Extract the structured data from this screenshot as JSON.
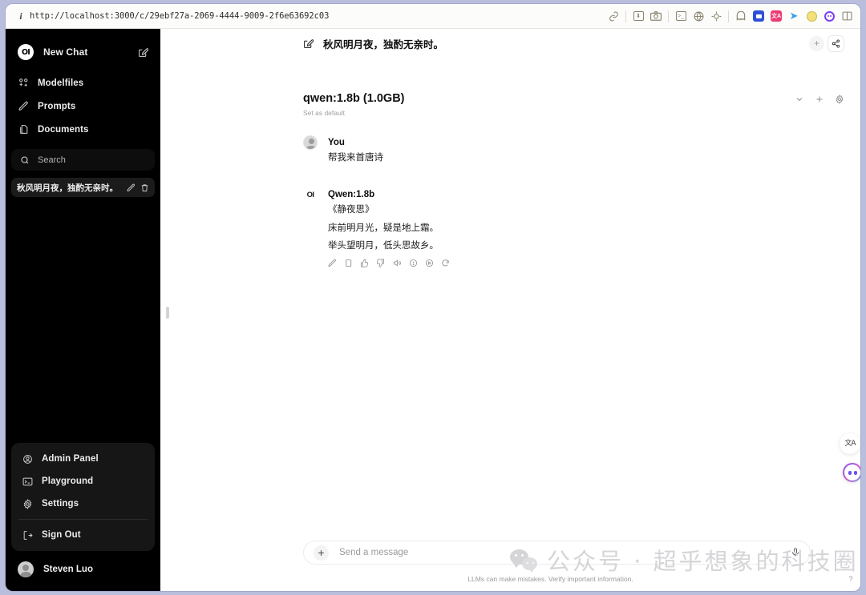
{
  "browser": {
    "url": "http://localhost:3000/c/29ebf27a-2069-4444-9009-2f6e63692c03",
    "info_icon": "i",
    "toolbar_icons": [
      {
        "name": "link-icon",
        "glyph": "⎇"
      },
      {
        "name": "download-box-icon",
        "glyph": "⬇"
      },
      {
        "name": "camera-icon",
        "glyph": "□"
      },
      {
        "name": "terminal-icon",
        "glyph": ">_"
      },
      {
        "name": "globe-icon",
        "glyph": "⊕"
      },
      {
        "name": "target-icon",
        "glyph": "◇"
      },
      {
        "name": "ghost-extension-icon",
        "glyph": "○"
      },
      {
        "name": "blue-app-icon",
        "glyph": ""
      },
      {
        "name": "pink-translate-icon",
        "glyph": "文A"
      },
      {
        "name": "bird-icon",
        "glyph": "➤"
      },
      {
        "name": "yellow-circle-icon",
        "glyph": "@"
      },
      {
        "name": "purple-face-icon",
        "glyph": "••"
      },
      {
        "name": "split-panel-icon",
        "glyph": "◫"
      }
    ]
  },
  "sidebar": {
    "new_chat": "New Chat",
    "nav_items": [
      {
        "label": "Modelfiles",
        "icon": "modelfiles-icon"
      },
      {
        "label": "Prompts",
        "icon": "pencil-icon"
      },
      {
        "label": "Documents",
        "icon": "documents-icon"
      }
    ],
    "search_placeholder": "Search",
    "history": [
      {
        "title": "秋风明月夜，独酌无亲时。"
      }
    ],
    "menu_items": [
      {
        "label": "Admin Panel",
        "icon": "admin-icon"
      },
      {
        "label": "Playground",
        "icon": "terminal-icon"
      },
      {
        "label": "Settings",
        "icon": "gear-icon"
      }
    ],
    "sign_out": "Sign Out",
    "user_name": "Steven Luo"
  },
  "chat": {
    "title": "秋风明月夜，独酌无亲时。",
    "model_name": "qwen:1.8b (1.0GB)",
    "set_as_default": "Set as default",
    "messages": [
      {
        "author": "You",
        "avatar": "user-avatar",
        "lines": [
          "帮我来首唐诗"
        ]
      },
      {
        "author": "Qwen:1.8b",
        "avatar": "openwebui-logo",
        "logo_text": "OI",
        "lines": [
          "《静夜思》",
          "床前明月光，疑是地上霜。",
          "举头望明月，低头思故乡。"
        ],
        "tools": [
          {
            "name": "edit-icon"
          },
          {
            "name": "copy-icon"
          },
          {
            "name": "thumbs-up-icon"
          },
          {
            "name": "thumbs-down-icon"
          },
          {
            "name": "speaker-icon"
          },
          {
            "name": "info-circle-icon"
          },
          {
            "name": "play-circle-icon"
          },
          {
            "name": "regenerate-icon"
          }
        ]
      }
    ]
  },
  "composer": {
    "placeholder": "Send a message",
    "plus_label": "+",
    "footnote": "LLMs can make mistakes. Verify important information."
  },
  "watermark": {
    "text": "公众号 · 超乎想象的科技圈"
  },
  "widgets": {
    "translate_glyph": "文A",
    "help_label": "?"
  },
  "colors": {
    "sidebar_bg": "#000000",
    "window_border": "#b9bedd",
    "accent_purple": "#7b5bf0"
  }
}
